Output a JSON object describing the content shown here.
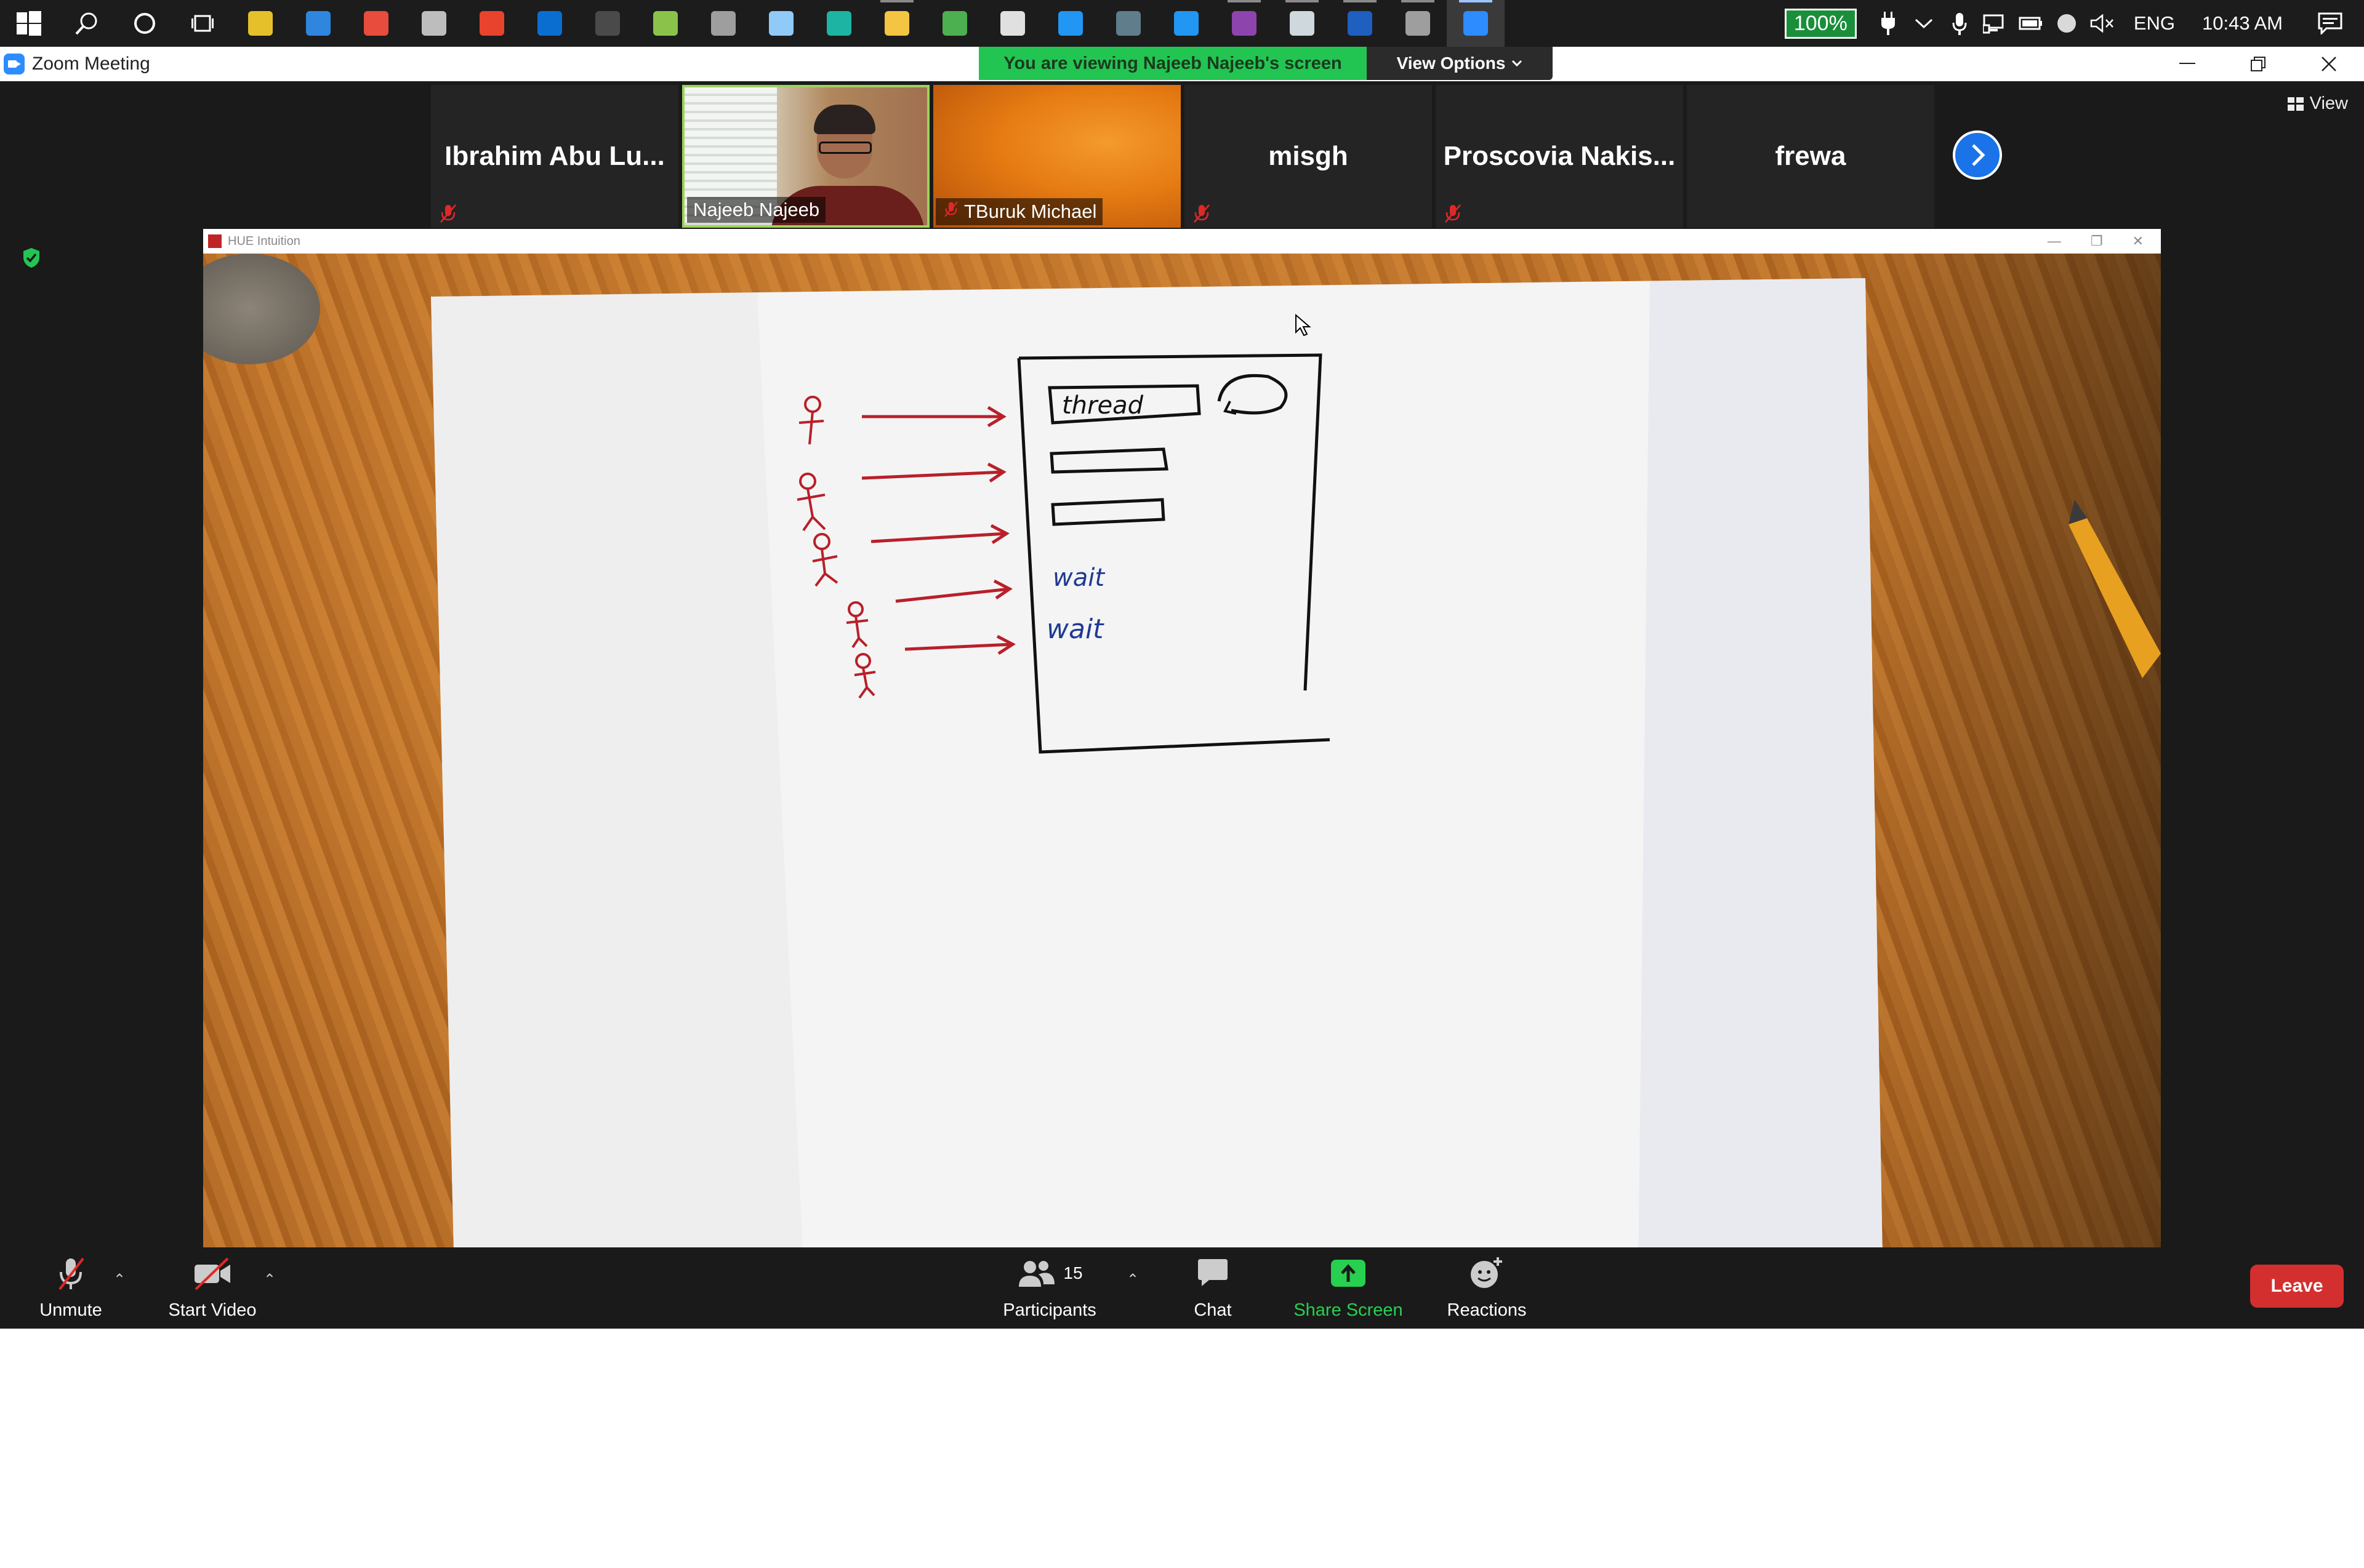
{
  "taskbar": {
    "apps": [
      {
        "name": "start",
        "color": "#ffffff"
      },
      {
        "name": "search",
        "color": "#ffffff"
      },
      {
        "name": "cortana",
        "color": "#ffffff"
      },
      {
        "name": "task-view",
        "color": "#ffffff"
      },
      {
        "name": "app-1",
        "color": "#e6c02a"
      },
      {
        "name": "app-2",
        "color": "#2e86de"
      },
      {
        "name": "app-3",
        "color": "#e74c3c"
      },
      {
        "name": "app-4",
        "color": "#bdbdbd"
      },
      {
        "name": "office",
        "color": "#e8432c"
      },
      {
        "name": "outlook",
        "color": "#0a6ed1"
      },
      {
        "name": "terminal",
        "color": "#4a4a4a"
      },
      {
        "name": "app-5",
        "color": "#8bc34a"
      },
      {
        "name": "app-6",
        "color": "#9e9e9e"
      },
      {
        "name": "app-7",
        "color": "#90caf9"
      },
      {
        "name": "edge",
        "color": "#1db4a3"
      },
      {
        "name": "file-explorer",
        "color": "#f4c542"
      },
      {
        "name": "chrome",
        "color": "#4caf50"
      },
      {
        "name": "store",
        "color": "#e0e0e0"
      },
      {
        "name": "mail",
        "color": "#2196f3"
      },
      {
        "name": "app-8",
        "color": "#607d8b"
      },
      {
        "name": "vscode",
        "color": "#2196f3"
      },
      {
        "name": "visual-studio",
        "color": "#8e44ad"
      },
      {
        "name": "app-9",
        "color": "#cfd8dc"
      },
      {
        "name": "word",
        "color": "#1e5fbf"
      },
      {
        "name": "app-10",
        "color": "#9e9e9e"
      },
      {
        "name": "zoom",
        "color": "#2d8cff"
      }
    ],
    "battery": "100%",
    "language": "ENG",
    "time": "10:43 AM"
  },
  "window": {
    "title": "Zoom Meeting"
  },
  "banner": {
    "viewing_text": "You are viewing Najeeb Najeeb's screen",
    "view_options": "View Options"
  },
  "gallery": {
    "participants": [
      {
        "name": "Ibrahim  Abu Lu...",
        "muted": true,
        "type": "name"
      },
      {
        "name": "Najeeb Najeeb",
        "muted": false,
        "type": "video"
      },
      {
        "name": "TBuruk Michael",
        "muted": true,
        "type": "orange"
      },
      {
        "name": "misgh",
        "muted": true,
        "type": "name"
      },
      {
        "name": "Proscovia  Nakis...",
        "muted": true,
        "type": "name"
      },
      {
        "name": "frewa",
        "muted": false,
        "type": "name"
      }
    ],
    "view_label": "View"
  },
  "shared_window": {
    "title": "HUE Intuition",
    "whiteboard": {
      "box_labels": [
        "thread",
        "wait",
        "wait"
      ]
    }
  },
  "toolbar": {
    "unmute": "Unmute",
    "start_video": "Start Video",
    "participants": "Participants",
    "participants_count": "15",
    "chat": "Chat",
    "share_screen": "Share Screen",
    "reactions": "Reactions",
    "leave": "Leave"
  },
  "colors": {
    "share_green": "#27d04f",
    "banner_green": "#23c552",
    "leave_red": "#d32f2f",
    "accent_blue": "#1a73e8",
    "marker_red": "#b8202a",
    "marker_blue": "#1f3a93"
  }
}
